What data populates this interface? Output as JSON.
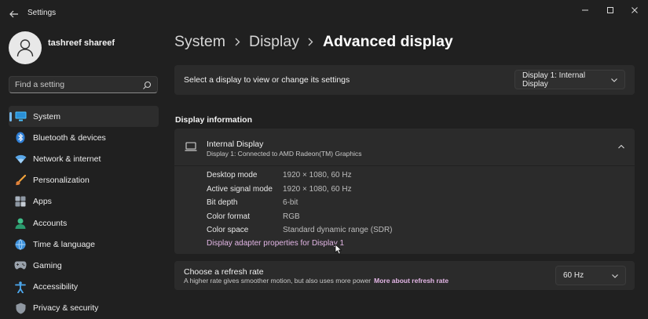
{
  "window": {
    "title": "Settings"
  },
  "user": {
    "name": "tashreef shareef"
  },
  "search": {
    "placeholder": "Find a setting"
  },
  "sidebar": {
    "items": [
      {
        "label": "System",
        "icon": "system-icon",
        "active": true
      },
      {
        "label": "Bluetooth & devices",
        "icon": "bluetooth-icon"
      },
      {
        "label": "Network & internet",
        "icon": "wifi-icon"
      },
      {
        "label": "Personalization",
        "icon": "brush-icon"
      },
      {
        "label": "Apps",
        "icon": "apps-icon"
      },
      {
        "label": "Accounts",
        "icon": "accounts-icon"
      },
      {
        "label": "Time & language",
        "icon": "globe-icon"
      },
      {
        "label": "Gaming",
        "icon": "gamepad-icon"
      },
      {
        "label": "Accessibility",
        "icon": "accessibility-icon"
      },
      {
        "label": "Privacy & security",
        "icon": "shield-icon"
      }
    ]
  },
  "breadcrumb": {
    "items": [
      "System",
      "Display"
    ],
    "current": "Advanced display"
  },
  "display_select": {
    "label": "Select a display to view or change its settings",
    "selected": "Display 1: Internal Display"
  },
  "display_info": {
    "section_title": "Display information",
    "title": "Internal Display",
    "subtitle": "Display 1: Connected to AMD Radeon(TM) Graphics",
    "properties": [
      {
        "name": "Desktop mode",
        "value": "1920 × 1080, 60 Hz"
      },
      {
        "name": "Active signal mode",
        "value": "1920 × 1080, 60 Hz"
      },
      {
        "name": "Bit depth",
        "value": "6-bit"
      },
      {
        "name": "Color format",
        "value": "RGB"
      },
      {
        "name": "Color space",
        "value": "Standard dynamic range (SDR)"
      }
    ],
    "adapter_link": "Display adapter properties for Display 1"
  },
  "refresh": {
    "title": "Choose a refresh rate",
    "description": "A higher rate gives smoother motion, but also uses more power",
    "link": "More about refresh rate",
    "selected": "60 Hz"
  },
  "colors": {
    "background": "#202020",
    "card": "#2b2b2b",
    "accent": "#76b9ed",
    "link": "#e3b6e6"
  }
}
